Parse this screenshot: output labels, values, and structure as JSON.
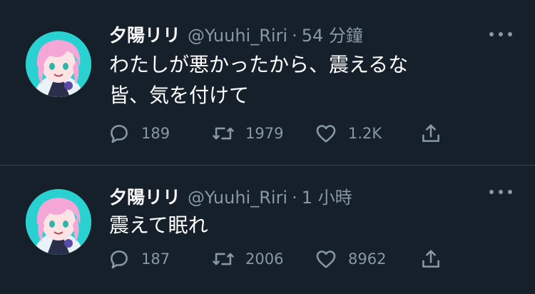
{
  "tweets": [
    {
      "name": "夕陽リリ",
      "handle": "@Yuuhi_Riri",
      "separator": "·",
      "time": "54 分鐘",
      "text_lines": [
        "わたしが悪かったから、震えるな",
        "皆、気を付けて"
      ],
      "reply_count": "189",
      "retweet_count": "1979",
      "like_count": "1.2K"
    },
    {
      "name": "夕陽リリ",
      "handle": "@Yuuhi_Riri",
      "separator": "·",
      "time": "1 小時",
      "text_lines": [
        "震えて眠れ"
      ],
      "reply_count": "187",
      "retweet_count": "2006",
      "like_count": "8962"
    }
  ],
  "icons": {
    "reply": "reply-icon",
    "retweet": "retweet-icon",
    "like": "heart-icon",
    "share": "share-icon",
    "more": "more-icon"
  },
  "colors": {
    "background": "#15202b",
    "text": "#ffffff",
    "secondary": "#8899a6",
    "divider": "#38444d",
    "avatar_bg": "#2ad1d1",
    "avatar_hair": "#f4a6d7"
  }
}
